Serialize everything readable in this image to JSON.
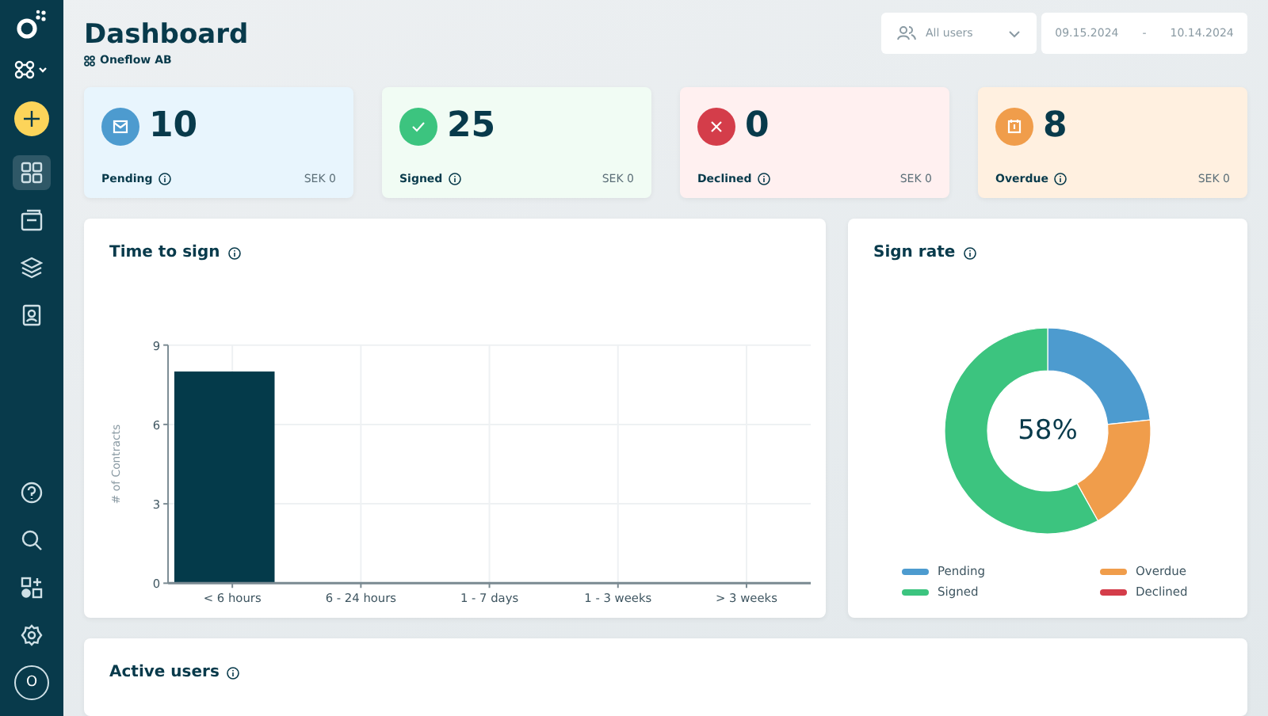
{
  "sidebar": {
    "avatar": "O",
    "top_items": [
      {
        "kind": "grid",
        "selected": true
      },
      {
        "kind": "document",
        "selected": false
      },
      {
        "kind": "layers",
        "selected": false
      },
      {
        "kind": "contacts",
        "selected": false
      }
    ],
    "bottom_items": [
      {
        "kind": "help"
      },
      {
        "kind": "search"
      },
      {
        "kind": "addons"
      },
      {
        "kind": "settings"
      }
    ]
  },
  "header": {
    "title": "Dashboard",
    "workspace": "Oneflow AB",
    "user_filter": {
      "value": "All users"
    },
    "date_range": {
      "from": "09.15.2024",
      "separator": "-",
      "to": "10.14.2024"
    }
  },
  "stat_cards": [
    {
      "kind": "pending",
      "count": "10",
      "label": "Pending",
      "amount": "SEK 0"
    },
    {
      "kind": "signed",
      "count": "25",
      "label": "Signed",
      "amount": "SEK 0"
    },
    {
      "kind": "declined",
      "count": "0",
      "label": "Declined",
      "amount": "SEK 0"
    },
    {
      "kind": "overdue",
      "count": "8",
      "label": "Overdue",
      "amount": "SEK 0"
    }
  ],
  "time_to_sign": {
    "title": "Time to sign",
    "chart_data": {
      "type": "bar",
      "ylabel": "# of Contracts",
      "categories": [
        "< 6 hours",
        "6 - 24 hours",
        "1 - 7 days",
        "1 - 3 weeks",
        "> 3 weeks"
      ],
      "values": [
        8,
        0,
        0,
        0,
        0
      ],
      "ylim": [
        0,
        9
      ],
      "yticks": [
        0,
        3,
        6,
        9
      ],
      "grid": true
    }
  },
  "sign_rate": {
    "title": "Sign rate",
    "center_label": "58%",
    "chart_data": {
      "type": "donut",
      "categories": [
        "Pending",
        "Overdue",
        "Signed",
        "Declined"
      ],
      "values": [
        23.3,
        18.6,
        58.1,
        0
      ],
      "colors": [
        "#4d9bcf",
        "#f09d4b",
        "#3cc47f",
        "#d43d4a"
      ]
    }
  },
  "active_users": {
    "title": "Active users"
  }
}
